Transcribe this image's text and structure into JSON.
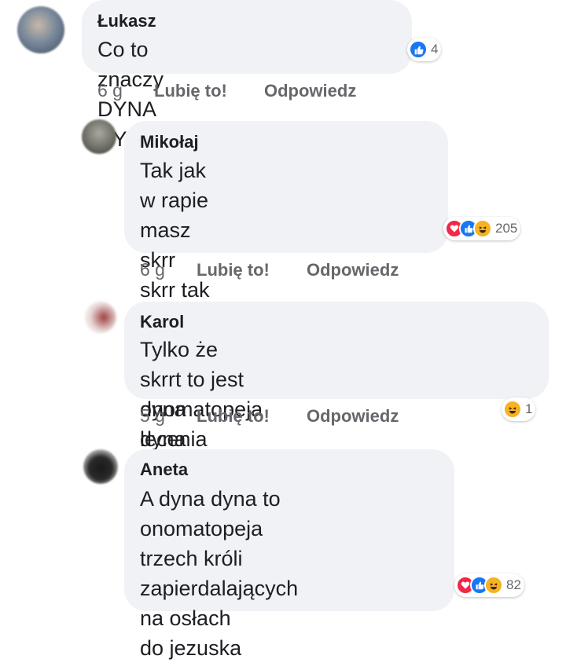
{
  "colors": {
    "bubble": "#f0f2f5",
    "like": "#1877f2",
    "love": "#f02849",
    "haha": "#f7b125",
    "meta": "#65676b"
  },
  "comments": [
    {
      "author": "Łukasz",
      "text": "Co to znaczy DYNA DYNA!!!",
      "age": "6 g",
      "like": "Lubię to!",
      "reply": "Odpowiedz",
      "reactions": [
        "like"
      ],
      "count": "4"
    },
    {
      "author": "Mikołaj",
      "text": "Tak jak w rapie masz skrr\nskrr tak w kolędach masz\ndyna dyna",
      "age": "6 g",
      "like": "Lubię to!",
      "reply": "Odpowiedz",
      "reactions": [
        "love",
        "like",
        "haha"
      ],
      "count": "205"
    },
    {
      "author": "Karol",
      "text": "Tylko że skrrt to jest onomatopeja\nlecenia bokiem",
      "age": "5 g",
      "like": "Lubię to!",
      "reply": "Odpowiedz",
      "reactions": [
        "haha"
      ],
      "count": "1"
    },
    {
      "author": "Aneta",
      "text": "A dyna dyna to\nonomatopeja trzech króli\nzapierdalających na osłach\ndo jezuska",
      "age": "",
      "like": "",
      "reply": "",
      "reactions": [
        "love",
        "like",
        "haha"
      ],
      "count": "82"
    }
  ]
}
